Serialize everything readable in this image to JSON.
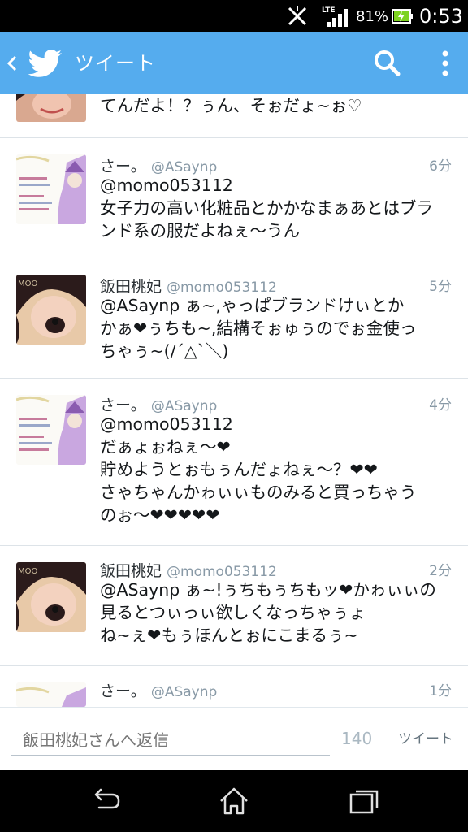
{
  "status_bar": {
    "network": "LTE",
    "battery_percent": "81%",
    "time": "0:53",
    "icons": [
      "no-sim-icon",
      "signal-icon",
      "battery-charging-icon"
    ]
  },
  "action_bar": {
    "title": "ツイート",
    "icons": [
      "back-arrow-icon",
      "twitter-bird-icon",
      "search-icon",
      "overflow-menu-icon"
    ],
    "color": "#55acee"
  },
  "tweets": [
    {
      "name": "",
      "handle": "",
      "time": "",
      "lines": [
        "てんだよ！？ぅん、そぉだょ~ぉ♡"
      ]
    },
    {
      "name": "さー。",
      "handle": "@ASaynp",
      "time": "6分",
      "lines": [
        "@momo053112",
        "女子力の高い化粧品とかかなまぁあとはブラ",
        "ンド系の服だよねぇ～うん"
      ]
    },
    {
      "name": "飯田桃妃",
      "handle": "@momo053112",
      "time": "5分",
      "lines": [
        "@ASaynp ぁ~,ゃっぱブランドけぃとか",
        "かぁ❤ぅちも~,結構そぉゅぅのでぉ金使っ",
        "ちゃぅ~(/´△`＼)"
      ]
    },
    {
      "name": "さー。",
      "handle": "@ASaynp",
      "time": "4分",
      "lines": [
        "@momo053112",
        "だぁょぉねぇ～❤",
        "貯めようとぉもぅんだょねぇ～？❤❤",
        "さゃちゃんかゎぃぃものみると買っちゃう",
        "のぉ～❤❤❤❤❤"
      ]
    },
    {
      "name": "飯田桃妃",
      "handle": "@momo053112",
      "time": "2分",
      "lines": [
        "@ASaynp ぁ~!ぅちもぅちもッ❤かゎぃぃの",
        "見るとつぃっぃ欲しくなっちゃぅょ",
        "ね~ぇ❤もぅほんとぉにこまるぅ~"
      ]
    },
    {
      "name": "さー。",
      "handle": "@ASaynp",
      "time": "1分",
      "lines": []
    }
  ],
  "reply_bar": {
    "placeholder": "飯田桃妃さんへ返信",
    "char_count": "140",
    "send_label": "ツイート"
  },
  "nav_bar": {
    "icons": [
      "back-icon",
      "home-icon",
      "recent-apps-icon"
    ]
  }
}
